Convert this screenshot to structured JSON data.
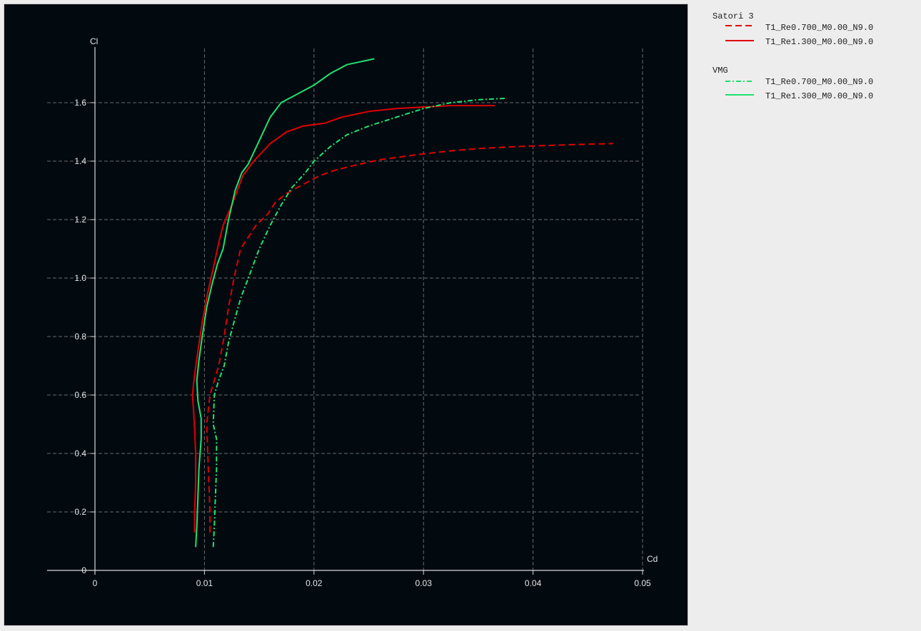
{
  "chart_data": {
    "type": "line",
    "xlabel": "Cd",
    "ylabel": "Cl",
    "xlim": [
      0,
      0.05
    ],
    "ylim": [
      0,
      1.8
    ],
    "x_ticks": [
      0,
      0.01,
      0.02,
      0.03,
      0.04,
      0.05
    ],
    "x_tick_labels": [
      "0",
      "0.01",
      "0.02",
      "0.03",
      "0.04",
      "0.05"
    ],
    "y_ticks": [
      0,
      0.2,
      0.4,
      0.6,
      0.8,
      1.0,
      1.2,
      1.4,
      1.6
    ],
    "y_tick_labels": [
      "0",
      "0.2",
      "0.4",
      "0.6",
      "0.8",
      "1.0",
      "1.2",
      "1.4",
      "1.6"
    ],
    "grid": true,
    "legend_position": "right",
    "groups": [
      {
        "name": "Satori 3",
        "series": [
          {
            "name": "T1_Re0.700_M0.00_N9.0",
            "color": "#e00000",
            "style": "dashed",
            "points": [
              [
                0.0105,
                0.13
              ],
              [
                0.0105,
                0.2
              ],
              [
                0.0104,
                0.3
              ],
              [
                0.0103,
                0.4
              ],
              [
                0.0102,
                0.5
              ],
              [
                0.0105,
                0.6
              ],
              [
                0.0113,
                0.7
              ],
              [
                0.0118,
                0.8
              ],
              [
                0.0122,
                0.9
              ],
              [
                0.0127,
                1.0
              ],
              [
                0.0133,
                1.1
              ],
              [
                0.0147,
                1.18
              ],
              [
                0.0158,
                1.22
              ],
              [
                0.0165,
                1.26
              ],
              [
                0.0175,
                1.29
              ],
              [
                0.019,
                1.32
              ],
              [
                0.0205,
                1.35
              ],
              [
                0.022,
                1.37
              ],
              [
                0.0242,
                1.39
              ],
              [
                0.026,
                1.405
              ],
              [
                0.028,
                1.415
              ],
              [
                0.03,
                1.425
              ],
              [
                0.0325,
                1.435
              ],
              [
                0.035,
                1.443
              ],
              [
                0.0375,
                1.448
              ],
              [
                0.04,
                1.452
              ],
              [
                0.0425,
                1.455
              ],
              [
                0.045,
                1.458
              ],
              [
                0.0473,
                1.46
              ]
            ]
          },
          {
            "name": "T1_Re1.300_M0.00_N9.0",
            "color": "#e00000",
            "style": "solid",
            "points": [
              [
                0.0091,
                0.13
              ],
              [
                0.0091,
                0.2
              ],
              [
                0.0092,
                0.3
              ],
              [
                0.0092,
                0.4
              ],
              [
                0.0091,
                0.48
              ],
              [
                0.009,
                0.55
              ],
              [
                0.0089,
                0.6
              ],
              [
                0.0091,
                0.67
              ],
              [
                0.0094,
                0.75
              ],
              [
                0.0098,
                0.85
              ],
              [
                0.0103,
                0.95
              ],
              [
                0.0109,
                1.05
              ],
              [
                0.0113,
                1.12
              ],
              [
                0.0117,
                1.18
              ],
              [
                0.0125,
                1.25
              ],
              [
                0.013,
                1.3
              ],
              [
                0.0135,
                1.35
              ],
              [
                0.0145,
                1.4
              ],
              [
                0.016,
                1.46
              ],
              [
                0.0175,
                1.5
              ],
              [
                0.019,
                1.52
              ],
              [
                0.021,
                1.53
              ],
              [
                0.0225,
                1.55
              ],
              [
                0.025,
                1.57
              ],
              [
                0.0275,
                1.58
              ],
              [
                0.03,
                1.585
              ],
              [
                0.0325,
                1.59
              ],
              [
                0.0345,
                1.59
              ],
              [
                0.0365,
                1.59
              ]
            ]
          }
        ]
      },
      {
        "name": "VMG",
        "series": [
          {
            "name": "T1_Re0.700_M0.00_N9.0",
            "color": "#20e070",
            "style": "dashdot",
            "points": [
              [
                0.0108,
                0.08
              ],
              [
                0.0109,
                0.15
              ],
              [
                0.011,
                0.25
              ],
              [
                0.0111,
                0.35
              ],
              [
                0.0111,
                0.45
              ],
              [
                0.0108,
                0.5
              ],
              [
                0.0109,
                0.6
              ],
              [
                0.0113,
                0.65
              ],
              [
                0.0118,
                0.7
              ],
              [
                0.0122,
                0.78
              ],
              [
                0.0127,
                0.85
              ],
              [
                0.0133,
                0.93
              ],
              [
                0.014,
                1.0
              ],
              [
                0.015,
                1.1
              ],
              [
                0.016,
                1.18
              ],
              [
                0.017,
                1.25
              ],
              [
                0.018,
                1.31
              ],
              [
                0.0192,
                1.36
              ],
              [
                0.02,
                1.4
              ],
              [
                0.0215,
                1.45
              ],
              [
                0.023,
                1.49
              ],
              [
                0.025,
                1.52
              ],
              [
                0.0275,
                1.55
              ],
              [
                0.03,
                1.58
              ],
              [
                0.0325,
                1.6
              ],
              [
                0.035,
                1.61
              ],
              [
                0.0375,
                1.615
              ]
            ]
          },
          {
            "name": "T1_Re1.300_M0.00_N9.0",
            "color": "#20e070",
            "style": "solid",
            "points": [
              [
                0.0092,
                0.08
              ],
              [
                0.0093,
                0.15
              ],
              [
                0.0094,
                0.25
              ],
              [
                0.0095,
                0.35
              ],
              [
                0.0097,
                0.45
              ],
              [
                0.0097,
                0.52
              ],
              [
                0.0094,
                0.58
              ],
              [
                0.0093,
                0.65
              ],
              [
                0.0095,
                0.72
              ],
              [
                0.0098,
                0.8
              ],
              [
                0.0102,
                0.9
              ],
              [
                0.0107,
                0.98
              ],
              [
                0.0112,
                1.05
              ],
              [
                0.0117,
                1.1
              ],
              [
                0.0122,
                1.2
              ],
              [
                0.0128,
                1.3
              ],
              [
                0.0134,
                1.36
              ],
              [
                0.014,
                1.39
              ],
              [
                0.015,
                1.47
              ],
              [
                0.016,
                1.55
              ],
              [
                0.017,
                1.6
              ],
              [
                0.0185,
                1.63
              ],
              [
                0.02,
                1.66
              ],
              [
                0.0215,
                1.7
              ],
              [
                0.023,
                1.73
              ],
              [
                0.0255,
                1.75
              ]
            ]
          }
        ]
      }
    ]
  }
}
